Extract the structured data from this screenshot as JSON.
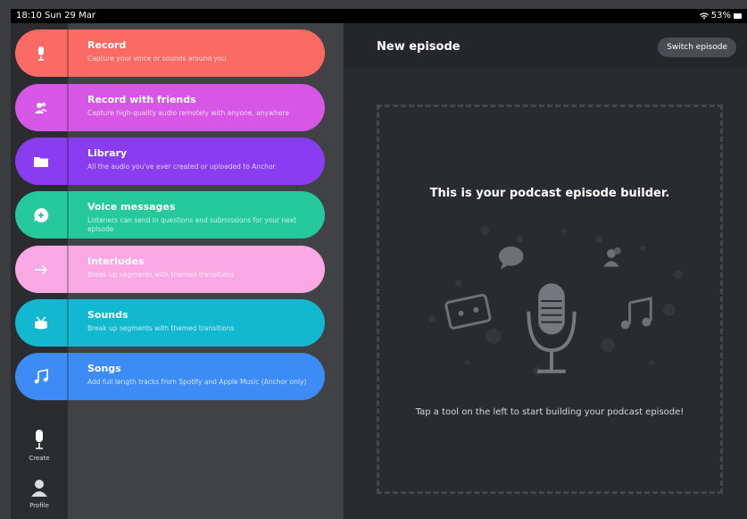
{
  "status": {
    "time_date": "18:10  Sun 29 Mar",
    "battery": "53%"
  },
  "tools": [
    {
      "title": "Record",
      "desc": "Capture your voice or sounds around you",
      "color": "#fb6b63",
      "icon": "microphone-icon"
    },
    {
      "title": "Record with friends",
      "desc": "Capture high-quality audio remotely with anyone, anywhere",
      "color": "#d657e6",
      "icon": "friends-icon"
    },
    {
      "title": "Library",
      "desc": "All the audio you've ever created or uploaded to Anchor",
      "color": "#8a3df0",
      "icon": "folder-icon"
    },
    {
      "title": "Voice messages",
      "desc": "Listeners can send in questions and submissions for your next episode",
      "color": "#25c99b",
      "icon": "voice-message-icon"
    },
    {
      "title": "Interludes",
      "desc": "Break up segments with themed transitions",
      "color": "#f9a8e4",
      "icon": "arrow-right-icon"
    },
    {
      "title": "Sounds",
      "desc": "Break up segments with themed transitions",
      "color": "#11b8cf",
      "icon": "drum-icon"
    },
    {
      "title": "Songs",
      "desc": "Add full length tracks from Spotify and Apple Music (Anchor only)",
      "color": "#3d8cf5",
      "icon": "music-note-icon"
    }
  ],
  "nav": {
    "create": "Create",
    "profile": "Profile"
  },
  "header": {
    "title": "New episode",
    "switch": "Switch episode"
  },
  "builder": {
    "headline": "This is your podcast episode builder.",
    "hint": "Tap a tool on the left to start building your podcast episode!"
  }
}
